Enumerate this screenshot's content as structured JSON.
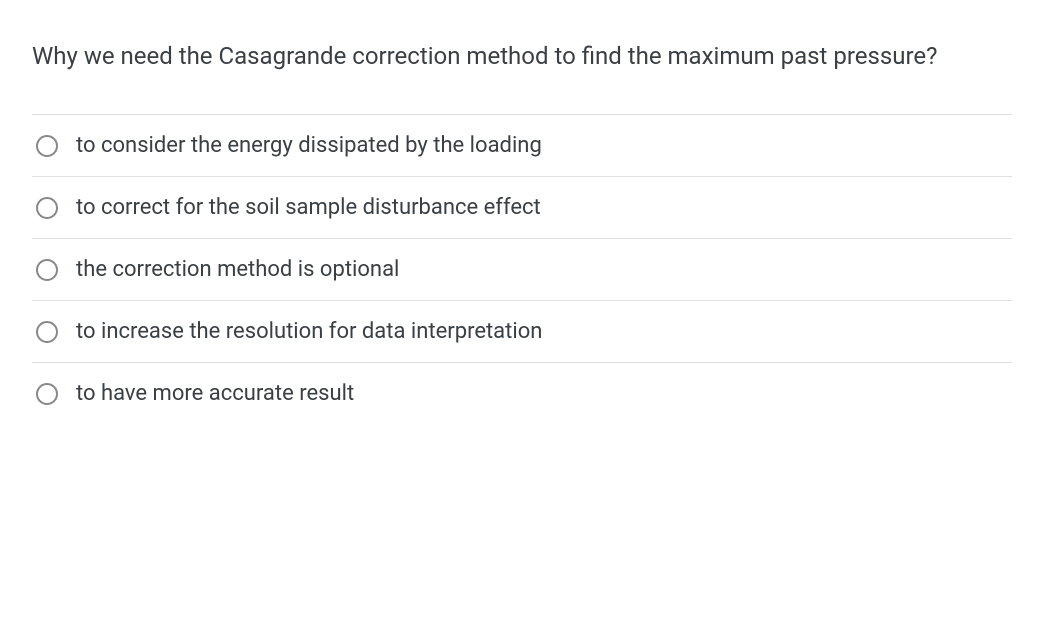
{
  "question": "Why we need the Casagrande correction method to find the maximum past pressure?",
  "options": [
    {
      "label": "to consider the energy dissipated by the loading"
    },
    {
      "label": "to correct for the soil sample disturbance effect"
    },
    {
      "label": "the correction method is optional"
    },
    {
      "label": "to increase the resolution for data interpretation"
    },
    {
      "label": "to have more accurate result"
    }
  ]
}
